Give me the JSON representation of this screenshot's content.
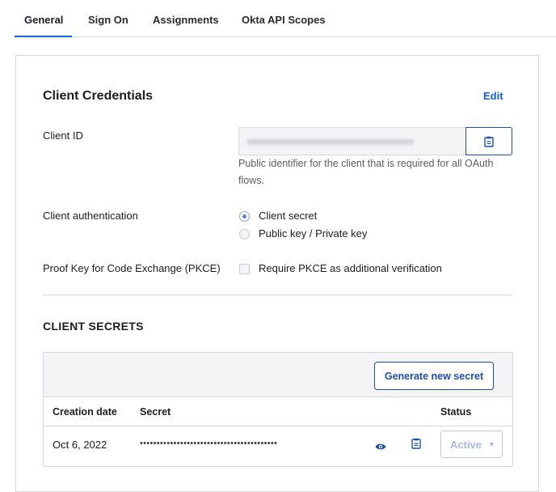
{
  "tabs": [
    {
      "label": "General",
      "active": true
    },
    {
      "label": "Sign On",
      "active": false
    },
    {
      "label": "Assignments",
      "active": false
    },
    {
      "label": "Okta API Scopes",
      "active": false
    }
  ],
  "credentials": {
    "title": "Client Credentials",
    "edit_label": "Edit",
    "client_id": {
      "label": "Client ID",
      "help": "Public identifier for the client that is required for all OAuth flows."
    },
    "client_auth": {
      "label": "Client authentication",
      "options": [
        {
          "label": "Client secret",
          "checked": true
        },
        {
          "label": "Public key / Private key",
          "checked": false
        }
      ]
    },
    "pkce": {
      "label": "Proof Key for Code Exchange (PKCE)",
      "checkbox_label": "Require PKCE as additional verification",
      "checked": false
    }
  },
  "secrets": {
    "title": "CLIENT SECRETS",
    "generate_label": "Generate new secret",
    "columns": {
      "creation_date": "Creation date",
      "secret": "Secret",
      "status": "Status"
    },
    "rows": [
      {
        "creation_date": "Oct 6, 2022",
        "secret": "•••••••••••••••••••••••••••••••••••••••••",
        "status": "Active"
      }
    ]
  },
  "colors": {
    "accent": "#1662dd",
    "button_border": "#1d4fa8"
  },
  "icons": {
    "copy": "clipboard-icon",
    "reveal": "eye-icon",
    "dropdown": "caret-down-icon"
  }
}
